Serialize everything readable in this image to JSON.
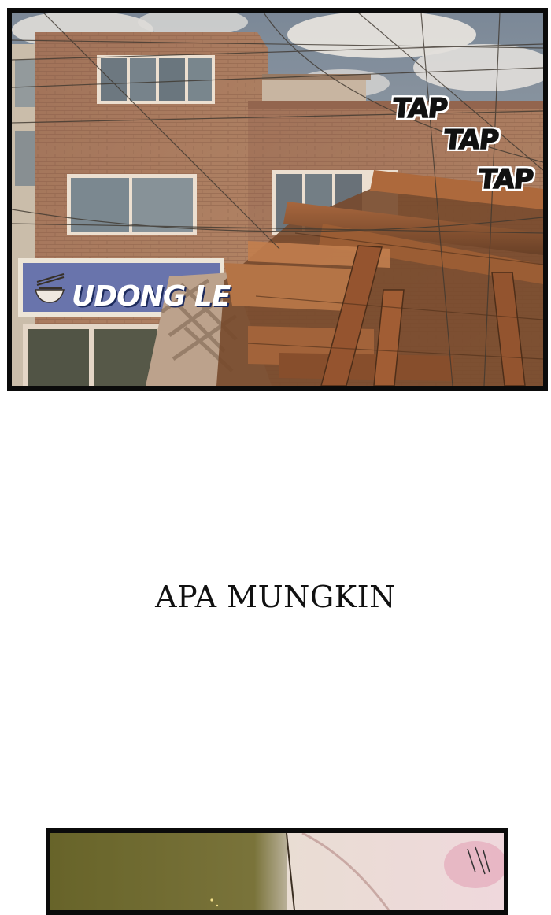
{
  "panel_1": {
    "sound_effects": [
      "TAP",
      "TAP",
      "TAP"
    ],
    "shop_sign": "UDONG LE"
  },
  "narration": "APA MUNGKIN",
  "colors": {
    "sky": "#7f98ae",
    "brick": "#a3765f",
    "sign_blue": "#5b6fb8",
    "wood": "#8a4f2e",
    "border": "#0b0b0b"
  }
}
